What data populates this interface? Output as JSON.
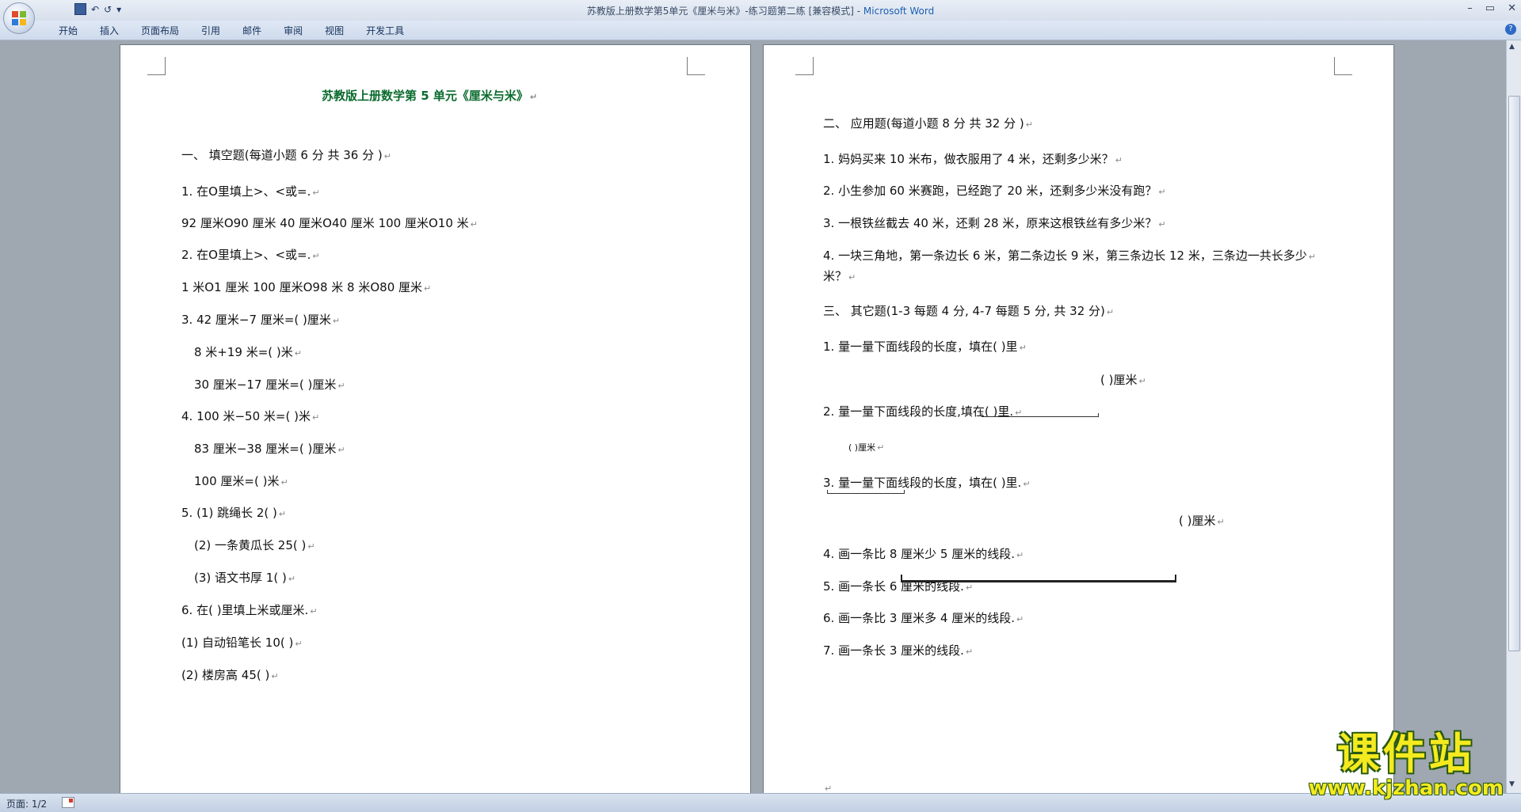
{
  "window": {
    "title": "苏教版上册数学第5单元《厘米与米》-练习题第二练 [兼容模式]",
    "app_name": "Microsoft Word",
    "separator": " - "
  },
  "quick_access": {
    "undo": "↶",
    "redo": "↺",
    "customize": "▾"
  },
  "window_controls": {
    "minimize": "–",
    "maximize": "▭",
    "close": "✕"
  },
  "ribbon": {
    "tabs": [
      "开始",
      "插入",
      "页面布局",
      "引用",
      "邮件",
      "审阅",
      "视图",
      "开发工具"
    ],
    "help": "?"
  },
  "left_page": {
    "title": "苏教版上册数学第 5 单元《厘米与米》",
    "lines": [
      "一、  填空题(每道小题  6 分  共  36 分 )",
      "1. 在O里填上>、<或=.",
      "92 厘米O90 厘米        40 厘米O40 厘米     100 厘米O10 米",
      "2. 在O里填上>、<或=.",
      "1 米O1 厘米            100 厘米O98 米            8 米O80 厘米",
      "3. 42 厘米−7 厘米=(            )厘米",
      "8 米+19 米=(            )米",
      "30 厘米−17 厘米=(            )厘米",
      "4. 100 米−50 米=(            )米",
      "83 厘米−38 厘米=(            )厘米",
      "100 厘米=(            )米",
      "5. (1)  跳绳长 2(            )",
      "(2)  一条黄瓜长 25(            )",
      "(3)  语文书厚 1(            )",
      "6. 在(            )里填上米或厘米.",
      "(1)  自动铅笔长 10(            )",
      "(2)  楼房高 45(            )"
    ]
  },
  "right_page": {
    "lines": [
      "二、  应用题(每道小题  8 分  共  32 分 )",
      "1. 妈妈买来 10 米布，做衣服用了 4 米，还剩多少米？",
      "2. 小生参加 60 米赛跑，已经跑了 20 米，还剩多少米没有跑？",
      "3. 一根铁丝截去 40 米，还剩 28 米，原来这根铁丝有多少米？",
      "4. 一块三角地，第一条边长 6 米，第二条边长 9 米，第三条边长 12 米，三条边一共长多少",
      "米？",
      "三、  其它题(1-3 每题  4 分, 4-7 每题  5 分, 共  32 分)",
      "1. 量一量下面线段的长度，填在(            )里",
      "(            )厘米",
      "2. 量一量下面线段的长度,填在(            )里.",
      "(    )厘米",
      "3. 量一量下面线段的长度，填在(            )里.",
      "(            )厘米",
      "4. 画一条比 8 厘米少 5 厘米的线段.",
      "5. 画一条长 6 厘米的线段.",
      "6. 画一条比 3 厘米多 4 厘米的线段.",
      "7. 画一条长 3 厘米的线段."
    ]
  },
  "paragraph_mark": "↵",
  "status": {
    "page": "页面: 1/2"
  },
  "watermark": {
    "line1": "课件站",
    "line2": "www.kjzhan.com"
  },
  "colors": {
    "title_green": "#0b6b2e",
    "watermark_yellow": "#f4ea1f"
  }
}
